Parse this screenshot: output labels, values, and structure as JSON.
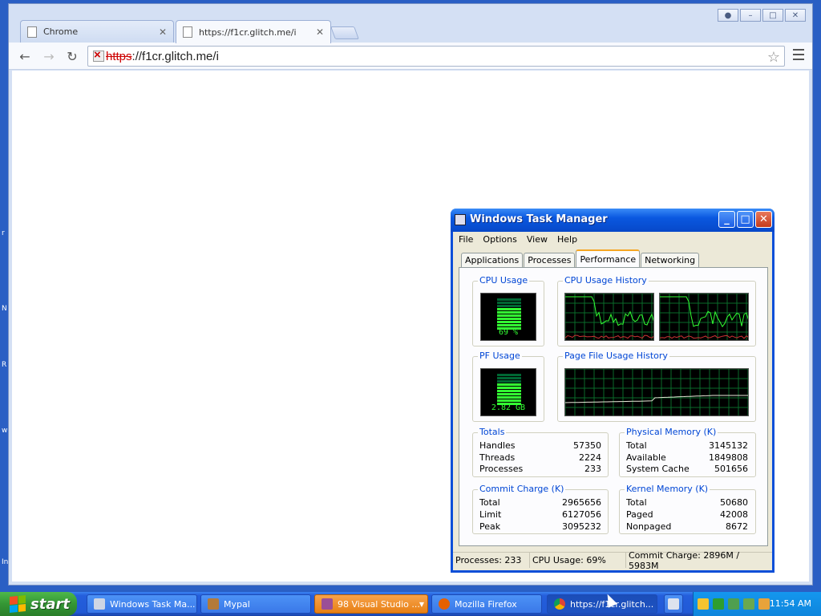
{
  "desktop": {
    "edge_glyphs": [
      "r",
      "N",
      "R",
      "w",
      "In"
    ]
  },
  "chrome": {
    "tabs": [
      {
        "title": "Chrome",
        "active": false
      },
      {
        "title": "https://f1cr.glitch.me/i",
        "active": true
      }
    ],
    "address": {
      "scheme": "https",
      "rest": "://f1cr.glitch.me/i"
    }
  },
  "taskmgr": {
    "title": "Windows Task Manager",
    "menu": [
      "File",
      "Options",
      "View",
      "Help"
    ],
    "tabs": [
      "Applications",
      "Processes",
      "Performance",
      "Networking"
    ],
    "active_tab": "Performance",
    "cpu_usage": {
      "label": "CPU Usage",
      "value_text": "69 %",
      "percent": 69
    },
    "cpu_history": {
      "label": "CPU Usage History"
    },
    "pf_usage": {
      "label": "PF Usage",
      "value_text": "2.82 GB"
    },
    "pf_history": {
      "label": "Page File Usage History"
    },
    "totals": {
      "label": "Totals",
      "rows": [
        {
          "k": "Handles",
          "v": "57350"
        },
        {
          "k": "Threads",
          "v": "2224"
        },
        {
          "k": "Processes",
          "v": "233"
        }
      ]
    },
    "physical": {
      "label": "Physical Memory (K)",
      "rows": [
        {
          "k": "Total",
          "v": "3145132"
        },
        {
          "k": "Available",
          "v": "1849808"
        },
        {
          "k": "System Cache",
          "v": "501656"
        }
      ]
    },
    "commit": {
      "label": "Commit Charge (K)",
      "rows": [
        {
          "k": "Total",
          "v": "2965656"
        },
        {
          "k": "Limit",
          "v": "6127056"
        },
        {
          "k": "Peak",
          "v": "3095232"
        }
      ]
    },
    "kernel": {
      "label": "Kernel Memory (K)",
      "rows": [
        {
          "k": "Total",
          "v": "50680"
        },
        {
          "k": "Paged",
          "v": "42008"
        },
        {
          "k": "Nonpaged",
          "v": "8672"
        }
      ]
    },
    "status": {
      "processes": "Processes: 233",
      "cpu": "CPU Usage: 69%",
      "commit": "Commit Charge: 2896M / 5983M"
    }
  },
  "taskbar": {
    "start_label": "start",
    "items": [
      {
        "label": "Windows Task Ma...",
        "icon": "taskmgr-icon"
      },
      {
        "label": "Mypal",
        "icon": "mypal-icon"
      },
      {
        "label": "98 Visual Studio ...",
        "icon": "visual-studio-icon"
      },
      {
        "label": "Mozilla Firefox",
        "icon": "firefox-icon"
      },
      {
        "label": "https://f1cr.glitch...",
        "icon": "chrome-icon"
      }
    ],
    "clock": "11:54 AM"
  },
  "colors": {
    "xp_blue": "#0748c8",
    "graph_green": "#33ff33",
    "start_green": "#349634"
  }
}
